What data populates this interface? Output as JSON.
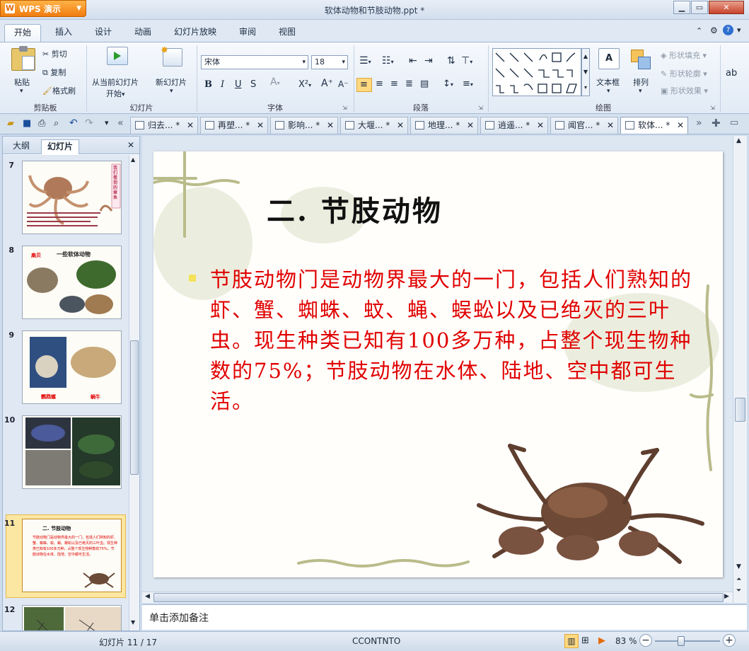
{
  "app": {
    "name": "WPS 演示",
    "title": "软体动物和节肢动物.ppt *"
  },
  "ribbon_tabs": [
    "开始",
    "插入",
    "设计",
    "动画",
    "幻灯片放映",
    "审阅",
    "视图"
  ],
  "clipboard": {
    "paste": "粘贴",
    "cut": "剪切",
    "copy": "复制",
    "format_painter": "格式刷",
    "label": "剪贴板"
  },
  "slides_group": {
    "from_current": "从当前幻灯片",
    "start": "开始",
    "new_slide": "新幻灯片",
    "label": "幻灯片"
  },
  "font_group": {
    "font_name": "宋体",
    "font_size": "18",
    "bold": "B",
    "italic": "I",
    "underline": "U",
    "shadow": "S",
    "label": "字体"
  },
  "paragraph_group": {
    "label": "段落"
  },
  "drawing_group": {
    "textbox": "文本框",
    "arrange": "排列",
    "shape_fill": "形状填充",
    "shape_outline": "形状轮廓",
    "shape_effect": "形状效果",
    "label": "绘图"
  },
  "doc_tabs": [
    {
      "label": "归去... *"
    },
    {
      "label": "再塑... *"
    },
    {
      "label": "影响... *"
    },
    {
      "label": "大堰... *"
    },
    {
      "label": "地理... *"
    },
    {
      "label": "逍遥... *"
    },
    {
      "label": "闻官... *"
    },
    {
      "label": "软体... *"
    }
  ],
  "left_panel": {
    "tab_outline": "大纲",
    "tab_slides": "幻灯片"
  },
  "thumbnails": [
    {
      "num": "7",
      "text": "我们看到的章鱼",
      "color": "#c04060"
    },
    {
      "num": "8",
      "text": "一些软体动物",
      "caption": "扇贝",
      "color": "#e00000"
    },
    {
      "num": "9",
      "caption_a": "鹦鹉螺",
      "caption_b": "蜗牛",
      "color": "#e00000"
    },
    {
      "num": "10"
    },
    {
      "num": "11",
      "title": "二. 节肢动物",
      "body": "节肢动物门是动物界最大的一门，包括人们熟知的虾、蟹、蜘蛛、蚊、蝇、蜈蚣以及已绝灭的三叶虫。现生种类已知有100多万种，占整个现生物种数的75%；节肢动物在水体、陆地、空中都可生活。"
    },
    {
      "num": "12"
    }
  ],
  "slide": {
    "title": "二. 节肢动物",
    "body": "节肢动物门是动物界最大的一门，包括人们熟知的虾、蟹、蜘蛛、蚊、蝇、蜈蚣以及已绝灭的三叶虫。现生种类已知有100多万种，占整个现生物种数的75%；节肢动物在水体、陆地、空中都可生活。"
  },
  "notes_placeholder": "单击添加备注",
  "status": {
    "slide_pos": "幻灯片 11 / 17",
    "theme": "CCONTNTO",
    "zoom": "83 %"
  }
}
